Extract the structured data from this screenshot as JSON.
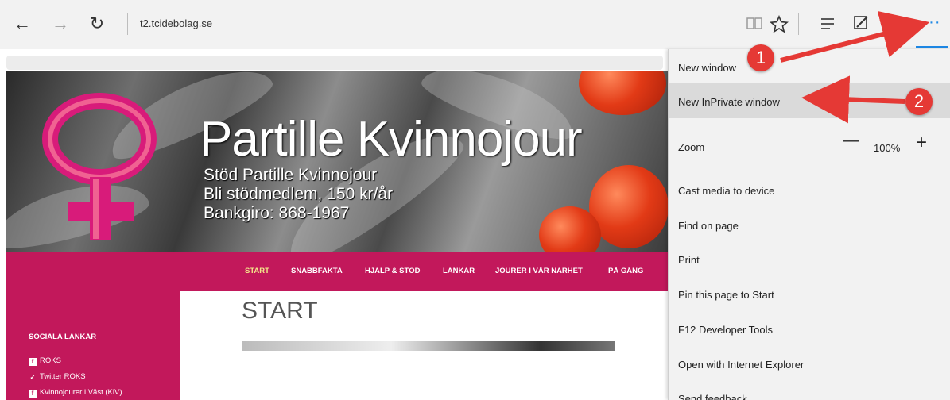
{
  "browser": {
    "nav": {
      "back_glyph": "←",
      "forward_glyph": "→",
      "refresh_glyph": "↻"
    },
    "address": "t2.tcidebolag.se",
    "toolbar_icons": [
      "reading-view-icon",
      "favorite-star-icon",
      "hub-icon",
      "web-note-icon",
      "share-icon",
      "more-icon"
    ],
    "more_glyph": "···",
    "accent_color": "#1e88e5"
  },
  "page": {
    "banner": {
      "title": "Partille Kvinnojour",
      "lines": [
        "Stöd Partille Kvinnojour",
        "Bli stödmedlem, 150 kr/år",
        "Bankgiro: 868-1967"
      ]
    },
    "nav": {
      "items": [
        "START",
        "SNABBFAKTA",
        "HJÄLP & STÖD",
        "LÄNKAR",
        "JOURER I VÅR NÄRHET",
        "PÅ GÅNG"
      ],
      "active_color": "#f3e58a",
      "bar_color": "#c2185b"
    },
    "sidebar": {
      "title": "SOCIALA LÄNKAR",
      "links": [
        "ROKS",
        "Twitter ROKS",
        "Kvinnojourer i Väst (KiV)"
      ]
    },
    "main": {
      "heading": "START"
    }
  },
  "menu": {
    "items": {
      "new_window": "New window",
      "new_inprivate": "New InPrivate window",
      "zoom": "Zoom",
      "cast": "Cast media to device",
      "find": "Find on page",
      "print": "Print",
      "pin": "Pin this page to Start",
      "f12": "F12 Developer Tools",
      "open_ie": "Open with Internet Explorer",
      "feedback": "Send feedback"
    },
    "zoom": {
      "value": "100%",
      "minus": "—",
      "plus": "+"
    }
  },
  "annotations": {
    "badge_1": "1",
    "badge_2": "2",
    "arrow_color": "#e53935"
  }
}
